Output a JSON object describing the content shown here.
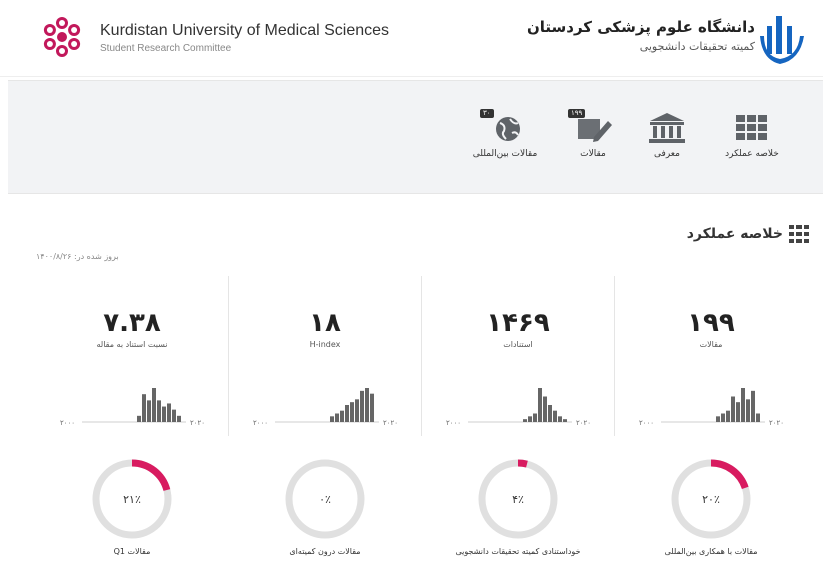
{
  "header": {
    "title_en": "Kurdistan University of Medical Sciences",
    "subtitle_en": "Student Research Committee",
    "title_fa": "دانشگاه علوم پزشکی کردستان",
    "subtitle_fa": "کمیته تحقیقات دانشجویی"
  },
  "nav": {
    "items": [
      {
        "label": "مقالات بین‌المللی",
        "icon": "globe-icon",
        "badge": "۳۰"
      },
      {
        "label": "مقالات",
        "icon": "pencil-icon",
        "badge": "۱۹۹"
      },
      {
        "label": "معرفی",
        "icon": "institution-icon"
      },
      {
        "label": "خلاصه عملکرد",
        "icon": "grid-icon"
      }
    ]
  },
  "summary": {
    "title": "خلاصه عملکرد",
    "updated": "بروز شده در: ۱۴۰۰/۸/۲۶"
  },
  "cards": [
    {
      "value": "۷.۳۸",
      "label": "نسبت استناد به مقاله",
      "axis_start": "۲۰۰۰",
      "axis_end": "۲۰۲۰",
      "bars": [
        2,
        9,
        7,
        11,
        7,
        5,
        6,
        4,
        2
      ]
    },
    {
      "value": "۱۸",
      "label": "H-index",
      "axis_start": "۲۰۰۰",
      "axis_end": "۲۰۲۰",
      "bars": [
        2,
        3,
        4,
        6,
        7,
        8,
        11,
        12,
        10
      ]
    },
    {
      "value": "۱۴۶۹",
      "label": "استنادات",
      "axis_start": "۲۰۰۰",
      "axis_end": "۲۰۲۰",
      "bars": [
        1,
        2,
        3,
        12,
        9,
        6,
        4,
        2,
        1
      ]
    },
    {
      "value": "۱۹۹",
      "label": "مقالات",
      "axis_start": "۲۰۰۰",
      "axis_end": "۲۰۲۰",
      "bars": [
        2,
        3,
        4,
        9,
        7,
        12,
        8,
        11,
        3
      ]
    }
  ],
  "donuts": [
    {
      "percent": 21,
      "text": "۲۱٪",
      "label": "مقالات Q1"
    },
    {
      "percent": 0,
      "text": "۰٪",
      "label": "مقالات درون کمیته‌ای"
    },
    {
      "percent": 4,
      "text": "۴٪",
      "label": "خوداستنادی کمیته تحقیقات دانشجویی"
    },
    {
      "percent": 20,
      "text": "۲۰٪",
      "label": "مقالات با همکاری بین‌المللی"
    }
  ],
  "colors": {
    "accent": "#d81b60",
    "ring": "#e0e0e0",
    "bar": "#666666",
    "logo_left": "#c2185b",
    "logo_right": "#1565c0"
  }
}
